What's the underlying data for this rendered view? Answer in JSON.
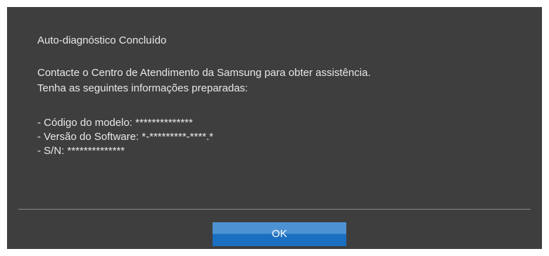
{
  "dialog": {
    "title": "Auto-diagnóstico Concluído",
    "message_lines": [
      "Contacte o Centro de Atendimento da Samsung para obter assistência.",
      "Tenha as seguintes informações preparadas:"
    ],
    "info_rows": [
      "- Código do modelo: **************",
      "- Versão do Software: *-*********-****.*",
      "- S/N: **************"
    ],
    "ok_label": "OK"
  },
  "colors": {
    "dialog_background": "#3e3e3e",
    "text": "#e8e8e8",
    "button_top": "#4d93d3",
    "button_bottom": "#1b6fc0",
    "divider": "#8a8a8a"
  }
}
